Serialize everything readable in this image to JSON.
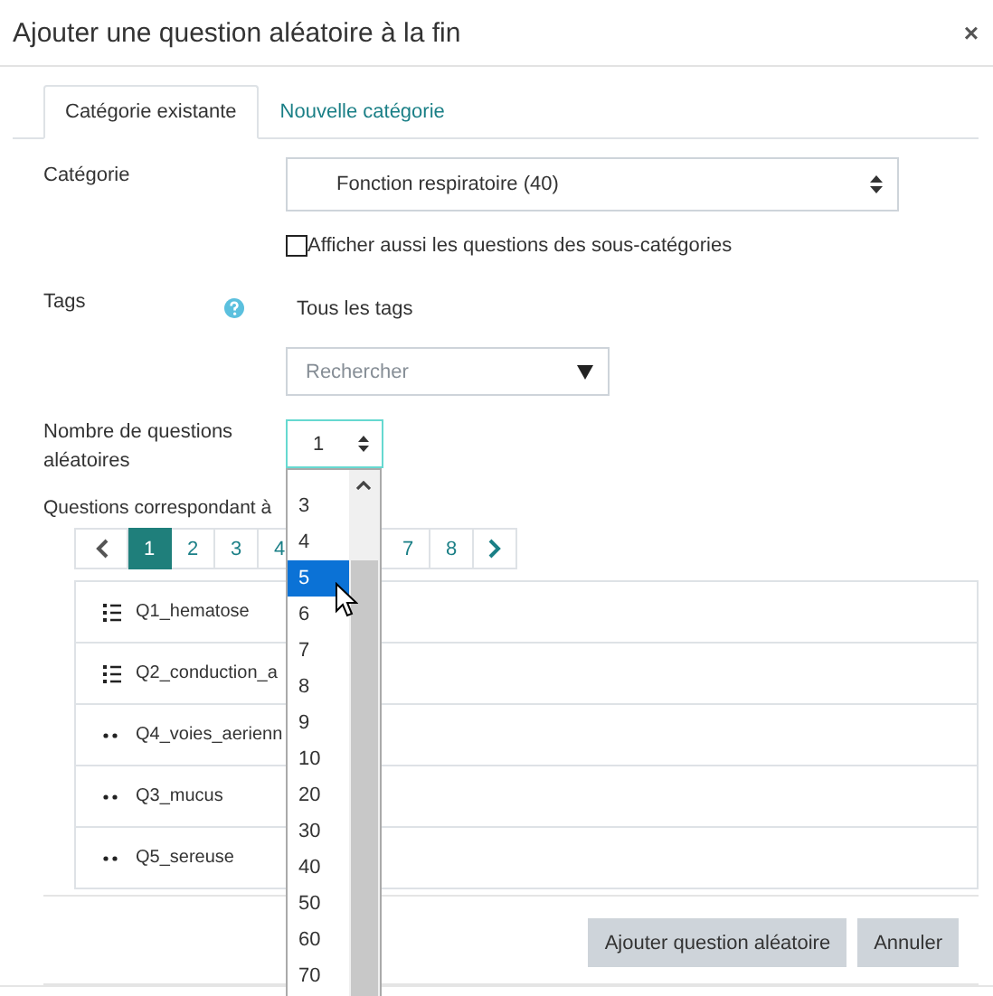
{
  "dialog": {
    "title": "Ajouter une question aléatoire à la fin",
    "close": "×"
  },
  "tabs": [
    {
      "label": "Catégorie existante",
      "selected": true
    },
    {
      "label": "Nouvelle catégorie",
      "selected": false
    }
  ],
  "category": {
    "label": "Catégorie",
    "value": "Fonction respiratoire (40)"
  },
  "subcategories": {
    "label": "Afficher aussi les questions des sous-catégories",
    "checked": false
  },
  "tags": {
    "label": "Tags",
    "value": "Tous les tags",
    "search_placeholder": "Rechercher"
  },
  "count": {
    "label": "Nombre de questions aléatoires",
    "value": "1",
    "options": [
      {
        "label": "3",
        "selected": false
      },
      {
        "label": "4",
        "selected": false
      },
      {
        "label": "5",
        "selected": true
      },
      {
        "label": "6",
        "selected": false
      },
      {
        "label": "7",
        "selected": false
      },
      {
        "label": "8",
        "selected": false
      },
      {
        "label": "9",
        "selected": false
      },
      {
        "label": "10",
        "selected": false
      },
      {
        "label": "20",
        "selected": false
      },
      {
        "label": "30",
        "selected": false
      },
      {
        "label": "40",
        "selected": false
      },
      {
        "label": "50",
        "selected": false
      },
      {
        "label": "60",
        "selected": false
      },
      {
        "label": "70",
        "selected": false
      }
    ]
  },
  "matching": {
    "label": "Questions correspondant à",
    "pages": [
      {
        "label": "1",
        "selected": true
      },
      {
        "label": "2",
        "selected": false
      },
      {
        "label": "3",
        "selected": false
      },
      {
        "label": "4",
        "selected": false
      },
      {
        "label": "7",
        "selected": false
      },
      {
        "label": "8",
        "selected": false
      }
    ],
    "questions": [
      {
        "kind": "list",
        "name": "Q1_hematose"
      },
      {
        "kind": "list",
        "name": "Q2_conduction_a"
      },
      {
        "kind": "dots",
        "name": "Q4_voies_aerienn"
      },
      {
        "kind": "dots",
        "name": "Q3_mucus"
      },
      {
        "kind": "dots",
        "name": "Q5_sereuse"
      }
    ]
  },
  "buttons": [
    "Ajouter question aléatoire",
    "Annuler"
  ]
}
